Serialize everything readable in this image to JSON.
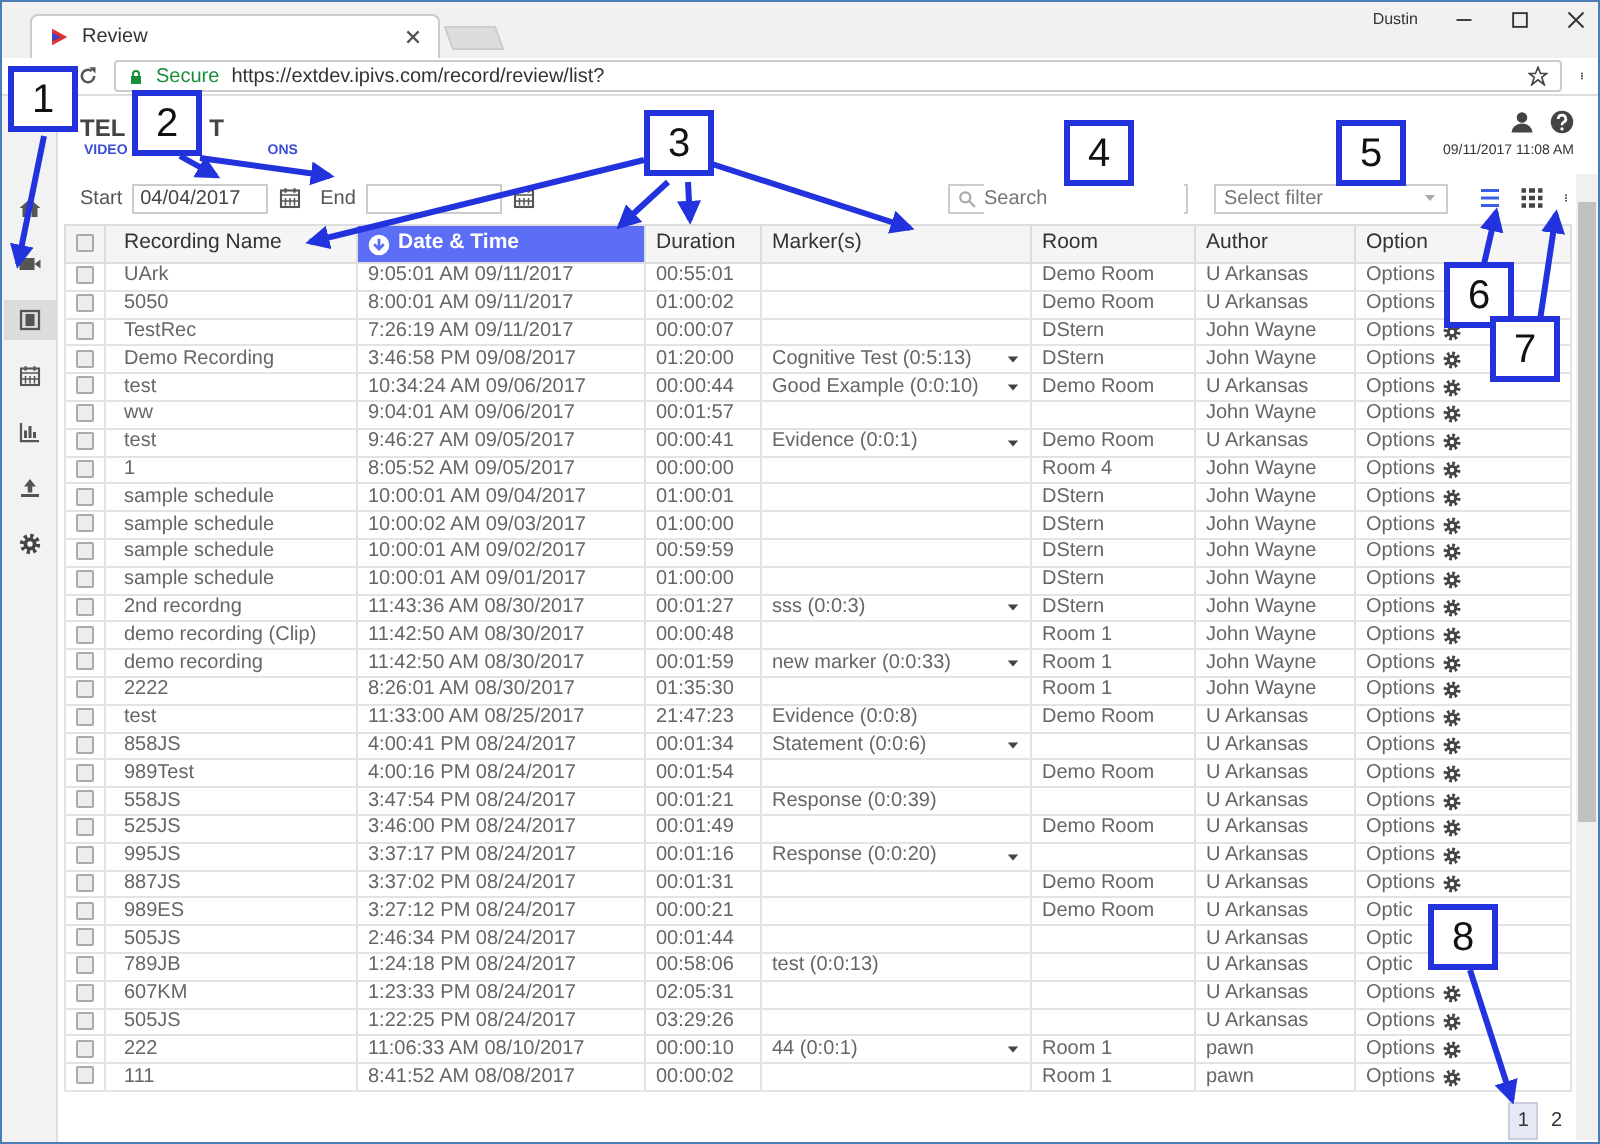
{
  "window": {
    "user": "Dustin"
  },
  "browser": {
    "tab_title": "Review",
    "secure_label": "Secure",
    "url": "https://extdev.ipivs.com/record/review/list?"
  },
  "logo": {
    "line1": [
      "TEL",
      "T"
    ],
    "line2": [
      "VIDEO",
      "ONS"
    ]
  },
  "header": {
    "datetime": "09/11/2017 11:08 AM"
  },
  "sidebar": {
    "items": [
      {
        "kind": "home",
        "selected": false
      },
      {
        "kind": "video",
        "selected": false
      },
      {
        "kind": "film",
        "selected": true
      },
      {
        "kind": "calendar",
        "selected": false
      },
      {
        "kind": "chart",
        "selected": false
      },
      {
        "kind": "upload",
        "selected": false
      },
      {
        "kind": "settings",
        "selected": false
      }
    ]
  },
  "filters": {
    "start_label": "Start",
    "start_value": "04/04/2017",
    "end_label": "End",
    "search_placeholder": "Search",
    "filter_placeholder": "Select filter",
    "list_view_active": true
  },
  "table": {
    "select_all_checked": false,
    "columns": [
      {
        "label": "Recording Name",
        "sorted": false
      },
      {
        "label": "Date & Time",
        "sorted": true
      },
      {
        "label": "Duration",
        "sorted": false
      },
      {
        "label": "Marker(s)",
        "sorted": false
      },
      {
        "label": "Room",
        "sorted": false
      },
      {
        "label": "Author",
        "sorted": false
      },
      {
        "label": "Option",
        "sorted": false
      }
    ],
    "rows": [
      {
        "checked": false,
        "name": "UArk",
        "date": "9:05:01 AM 09/11/2017",
        "duration": "00:55:01",
        "room": "Demo Room",
        "author": "U Arkansas",
        "options": "Options",
        "gear": false
      },
      {
        "checked": false,
        "name": "5050",
        "date": "8:00:01 AM 09/11/2017",
        "duration": "01:00:02",
        "room": "Demo Room",
        "author": "U Arkansas",
        "options": "Options",
        "gear": false
      },
      {
        "checked": false,
        "name": "TestRec",
        "date": "7:26:19 AM 09/11/2017",
        "duration": "00:00:07",
        "room": "DStern",
        "author": "John Wayne",
        "options": "Options",
        "gear": true
      },
      {
        "checked": false,
        "name": "Demo Recording",
        "date": "3:46:58 PM 09/08/2017",
        "duration": "01:20:00",
        "marker": {
          "text": "Cognitive Test (0:5:13)",
          "dropdown": true
        },
        "room": "DStern",
        "author": "John Wayne",
        "options": "Options",
        "gear": true
      },
      {
        "checked": false,
        "name": "test",
        "date": "10:34:24 AM 09/06/2017",
        "duration": "00:00:44",
        "marker": {
          "text": "Good Example (0:0:10)",
          "dropdown": true
        },
        "room": "Demo Room",
        "author": "U Arkansas",
        "options": "Options",
        "gear": true
      },
      {
        "checked": false,
        "name": "ww",
        "date": "9:04:01 AM 09/06/2017",
        "duration": "00:01:57",
        "author": "John Wayne",
        "options": "Options",
        "gear": true
      },
      {
        "checked": false,
        "name": "test",
        "date": "9:46:27 AM 09/05/2017",
        "duration": "00:00:41",
        "marker": {
          "text": "Evidence (0:0:1)",
          "dropdown": true
        },
        "room": "Demo Room",
        "author": "U Arkansas",
        "options": "Options",
        "gear": true
      },
      {
        "checked": false,
        "name": "1",
        "date": "8:05:52 AM 09/05/2017",
        "duration": "00:00:00",
        "room": "Room 4",
        "author": "John Wayne",
        "options": "Options",
        "gear": true
      },
      {
        "checked": false,
        "name": "sample schedule",
        "date": "10:00:01 AM 09/04/2017",
        "duration": "01:00:01",
        "room": "DStern",
        "author": "John Wayne",
        "options": "Options",
        "gear": true
      },
      {
        "checked": false,
        "name": "sample schedule",
        "date": "10:00:02 AM 09/03/2017",
        "duration": "01:00:00",
        "room": "DStern",
        "author": "John Wayne",
        "options": "Options",
        "gear": true
      },
      {
        "checked": false,
        "name": "sample schedule",
        "date": "10:00:01 AM 09/02/2017",
        "duration": "00:59:59",
        "room": "DStern",
        "author": "John Wayne",
        "options": "Options",
        "gear": true
      },
      {
        "checked": false,
        "name": "sample schedule",
        "date": "10:00:01 AM 09/01/2017",
        "duration": "01:00:00",
        "room": "DStern",
        "author": "John Wayne",
        "options": "Options",
        "gear": true
      },
      {
        "checked": false,
        "name": "2nd recordng",
        "date": "11:43:36 AM 08/30/2017",
        "duration": "00:01:27",
        "marker": {
          "text": "sss (0:0:3)",
          "dropdown": true
        },
        "room": "DStern",
        "author": "John Wayne",
        "options": "Options",
        "gear": true
      },
      {
        "checked": false,
        "name": "demo recording (Clip)",
        "date": "11:42:50 AM 08/30/2017",
        "duration": "00:00:48",
        "room": "Room 1",
        "author": "John Wayne",
        "options": "Options",
        "gear": true
      },
      {
        "checked": false,
        "name": "demo recording",
        "date": "11:42:50 AM 08/30/2017",
        "duration": "00:01:59",
        "marker": {
          "text": "new marker (0:0:33)",
          "dropdown": true
        },
        "room": "Room 1",
        "author": "John Wayne",
        "options": "Options",
        "gear": true
      },
      {
        "checked": false,
        "name": "2222",
        "date": "8:26:01 AM 08/30/2017",
        "duration": "01:35:30",
        "room": "Room 1",
        "author": "John Wayne",
        "options": "Options",
        "gear": true
      },
      {
        "checked": false,
        "name": "test",
        "date": "11:33:00 AM 08/25/2017",
        "duration": "21:47:23",
        "marker": {
          "text": "Evidence (0:0:8)",
          "dropdown": false
        },
        "room": "Demo Room",
        "author": "U Arkansas",
        "options": "Options",
        "gear": true
      },
      {
        "checked": false,
        "name": "858JS",
        "date": "4:00:41 PM 08/24/2017",
        "duration": "00:01:34",
        "marker": {
          "text": "Statement (0:0:6)",
          "dropdown": true
        },
        "author": "U Arkansas",
        "options": "Options",
        "gear": true
      },
      {
        "checked": false,
        "name": "989Test",
        "date": "4:00:16 PM 08/24/2017",
        "duration": "00:01:54",
        "room": "Demo Room",
        "author": "U Arkansas",
        "options": "Options",
        "gear": true
      },
      {
        "checked": false,
        "name": "558JS",
        "date": "3:47:54 PM 08/24/2017",
        "duration": "00:01:21",
        "marker": {
          "text": "Response (0:0:39)",
          "dropdown": false
        },
        "author": "U Arkansas",
        "options": "Options",
        "gear": true
      },
      {
        "checked": false,
        "name": "525JS",
        "date": "3:46:00 PM 08/24/2017",
        "duration": "00:01:49",
        "room": "Demo Room",
        "author": "U Arkansas",
        "options": "Options",
        "gear": true
      },
      {
        "checked": false,
        "name": "995JS",
        "date": "3:37:17 PM 08/24/2017",
        "duration": "00:01:16",
        "marker": {
          "text": "Response (0:0:20)",
          "dropdown": true
        },
        "author": "U Arkansas",
        "options": "Options",
        "gear": true
      },
      {
        "checked": false,
        "name": "887JS",
        "date": "3:37:02 PM 08/24/2017",
        "duration": "00:01:31",
        "room": "Demo Room",
        "author": "U Arkansas",
        "options": "Options",
        "gear": true
      },
      {
        "checked": false,
        "name": "989ES",
        "date": "3:27:12 PM 08/24/2017",
        "duration": "00:00:21",
        "room": "Demo Room",
        "author": "U Arkansas",
        "options": "Optic",
        "gear": false
      },
      {
        "checked": false,
        "name": "505JS",
        "date": "2:46:34 PM 08/24/2017",
        "duration": "00:01:44",
        "author": "U Arkansas",
        "options": "Optic",
        "gear": false
      },
      {
        "checked": false,
        "name": "789JB",
        "date": "1:24:18 PM 08/24/2017",
        "duration": "00:58:06",
        "marker": {
          "text": "test (0:0:13)",
          "dropdown": false
        },
        "author": "U Arkansas",
        "options": "Optic",
        "gear": false
      },
      {
        "checked": false,
        "name": "607KM",
        "date": "1:23:33 PM 08/24/2017",
        "duration": "02:05:31",
        "author": "U Arkansas",
        "options": "Options",
        "gear": true
      },
      {
        "checked": false,
        "name": "505JS",
        "date": "1:22:25 PM 08/24/2017",
        "duration": "03:29:26",
        "author": "U Arkansas",
        "options": "Options",
        "gear": true
      },
      {
        "checked": false,
        "name": "222",
        "date": "11:06:33 AM 08/10/2017",
        "duration": "00:00:10",
        "marker": {
          "text": "44 (0:0:1)",
          "dropdown": true
        },
        "room": "Room 1",
        "author": "pawn",
        "options": "Options",
        "gear": true
      },
      {
        "checked": false,
        "name": "111",
        "date": "8:41:52 AM 08/08/2017",
        "duration": "00:00:02",
        "room": "Room 1",
        "author": "pawn",
        "options": "Options",
        "gear": true
      }
    ]
  },
  "pagination": [
    {
      "label": "1",
      "selected": true
    },
    {
      "label": "2",
      "selected": false
    }
  ],
  "callouts": [
    {
      "label": "1"
    },
    {
      "label": "2"
    },
    {
      "label": "3"
    },
    {
      "label": "4"
    },
    {
      "label": "5"
    },
    {
      "label": "6"
    },
    {
      "label": "7"
    },
    {
      "label": "8"
    }
  ]
}
